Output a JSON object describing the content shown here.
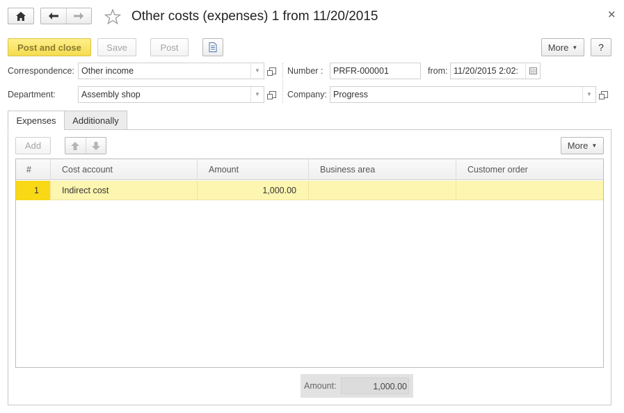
{
  "window": {
    "title": "Other costs (expenses) 1 from 11/20/2015"
  },
  "toolbar": {
    "post_and_close": "Post and close",
    "save": "Save",
    "post": "Post",
    "more": "More",
    "help": "?"
  },
  "header": {
    "correspondence": {
      "label": "Correspondence:",
      "value": "Other income"
    },
    "department": {
      "label": "Department:",
      "value": "Assembly shop"
    },
    "number": {
      "label": "Number :",
      "value": "PRFR-000001"
    },
    "from": {
      "label": "from:",
      "value": "11/20/2015  2:02:"
    },
    "company": {
      "label": "Company:",
      "value": "Progress"
    }
  },
  "tabs": [
    {
      "label": "Expenses",
      "active": true
    },
    {
      "label": "Additionally",
      "active": false
    }
  ],
  "table_toolbar": {
    "add": "Add",
    "more": "More"
  },
  "table": {
    "columns": [
      "#",
      "Cost account",
      "Amount",
      "Business area",
      "Customer order"
    ],
    "rows": [
      {
        "num": "1",
        "cost_account": "Indirect cost",
        "amount": "1,000.00",
        "business_area": "",
        "customer_order": ""
      }
    ]
  },
  "footer": {
    "amount_label": "Amount:",
    "amount_value": "1,000.00"
  },
  "colors": {
    "selected_row": "#fdf6b0",
    "selected_cell": "#f9d815",
    "primary_button": "#f4dc4e"
  }
}
